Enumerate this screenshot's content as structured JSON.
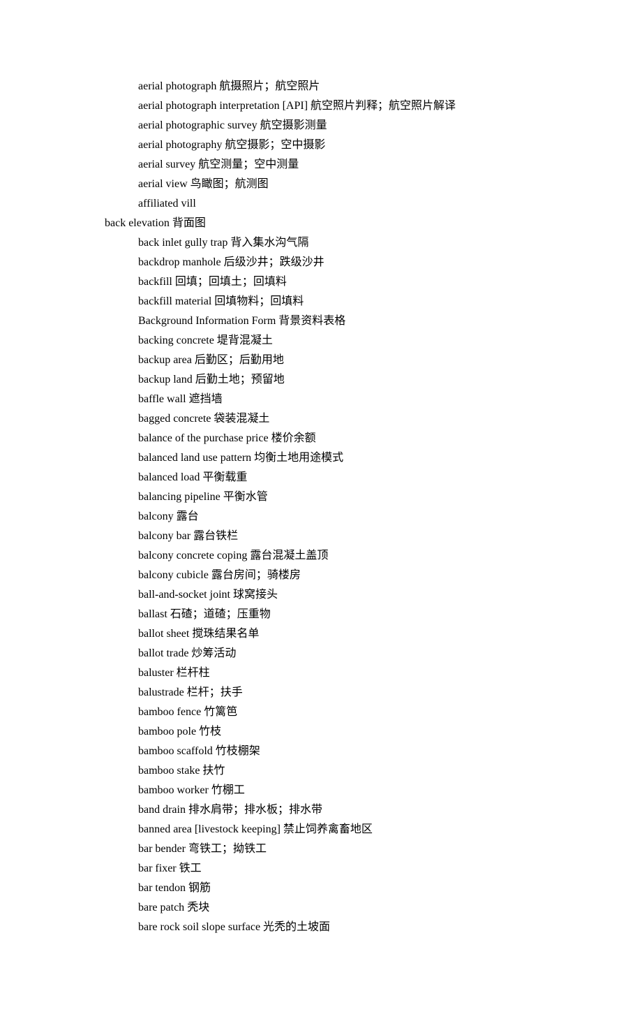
{
  "entries": [
    {
      "indent": true,
      "en": "aerial photograph",
      "zh": "航摄照片；航空照片"
    },
    {
      "indent": true,
      "en": "aerial photograph interpretation [API]",
      "zh": "航空照片判释；航空照片解译"
    },
    {
      "indent": true,
      "en": "aerial photographic survey",
      "zh": "航空摄影测量"
    },
    {
      "indent": true,
      "en": "aerial photography",
      "zh": "航空摄影；空中摄影"
    },
    {
      "indent": true,
      "en": "aerial survey",
      "zh": "航空测量；空中测量"
    },
    {
      "indent": true,
      "en": "aerial view",
      "zh": "鸟瞰图；航测图"
    },
    {
      "indent": true,
      "en": "affiliated vill",
      "zh": ""
    },
    {
      "indent": false,
      "en": "back elevation",
      "zh": "背面图"
    },
    {
      "indent": true,
      "en": "back inlet gully trap",
      "zh": "背入集水沟气隔"
    },
    {
      "indent": true,
      "en": "backdrop manhole",
      "zh": "后级沙井；跌级沙井"
    },
    {
      "indent": true,
      "en": "backfill",
      "zh": "回填；回填土；回填料"
    },
    {
      "indent": true,
      "en": "backfill material",
      "zh": "回填物料；回填料"
    },
    {
      "indent": true,
      "en": "Background Information Form",
      "zh": "背景资料表格"
    },
    {
      "indent": true,
      "en": "backing concrete",
      "zh": "堤背混凝土"
    },
    {
      "indent": true,
      "en": "backup area",
      "zh": "后勤区；后勤用地"
    },
    {
      "indent": true,
      "en": "backup land",
      "zh": "后勤土地；预留地"
    },
    {
      "indent": true,
      "en": "baffle wall",
      "zh": "遮挡墙"
    },
    {
      "indent": true,
      "en": "bagged concrete",
      "zh": "袋装混凝土"
    },
    {
      "indent": true,
      "en": "balance of the purchase price",
      "zh": "楼价余额"
    },
    {
      "indent": true,
      "en": "balanced land use pattern",
      "zh": "均衡土地用途模式"
    },
    {
      "indent": true,
      "en": "balanced load",
      "zh": "平衡载重"
    },
    {
      "indent": true,
      "en": "balancing pipeline",
      "zh": "平衡水管"
    },
    {
      "indent": true,
      "en": "balcony",
      "zh": "露台"
    },
    {
      "indent": true,
      "en": "balcony bar",
      "zh": "露台铁栏"
    },
    {
      "indent": true,
      "en": "balcony concrete coping",
      "zh": "露台混凝土盖顶"
    },
    {
      "indent": true,
      "en": "balcony cubicle",
      "zh": "露台房间；骑楼房"
    },
    {
      "indent": true,
      "en": "ball-and-socket joint",
      "zh": "球窝接头"
    },
    {
      "indent": true,
      "en": "ballast",
      "zh": "石碴；道碴；压重物"
    },
    {
      "indent": true,
      "en": "ballot sheet",
      "zh": "搅珠结果名单"
    },
    {
      "indent": true,
      "en": "ballot trade",
      "zh": "炒筹活动"
    },
    {
      "indent": true,
      "en": "baluster",
      "zh": "栏杆柱"
    },
    {
      "indent": true,
      "en": "balustrade",
      "zh": "栏杆；扶手"
    },
    {
      "indent": true,
      "en": "bamboo fence",
      "zh": "竹篱笆"
    },
    {
      "indent": true,
      "en": "bamboo pole",
      "zh": "竹枝"
    },
    {
      "indent": true,
      "en": "bamboo scaffold",
      "zh": "竹枝棚架"
    },
    {
      "indent": true,
      "en": "bamboo stake",
      "zh": "扶竹"
    },
    {
      "indent": true,
      "en": "bamboo worker",
      "zh": "竹棚工"
    },
    {
      "indent": true,
      "en": "band drain",
      "zh": "排水肩带；排水板；排水带"
    },
    {
      "indent": true,
      "en": "banned area [livestock keeping]",
      "zh": "禁止饲养禽畜地区"
    },
    {
      "indent": true,
      "en": "bar bender",
      "zh": "弯铁工；拗铁工"
    },
    {
      "indent": true,
      "en": "bar fixer",
      "zh": "铁工"
    },
    {
      "indent": true,
      "en": "bar tendon",
      "zh": "钢筋"
    },
    {
      "indent": true,
      "en": "bare patch",
      "zh": "秃块"
    },
    {
      "indent": true,
      "en": "bare rock soil slope surface",
      "zh": "光秃的土坡面"
    }
  ]
}
